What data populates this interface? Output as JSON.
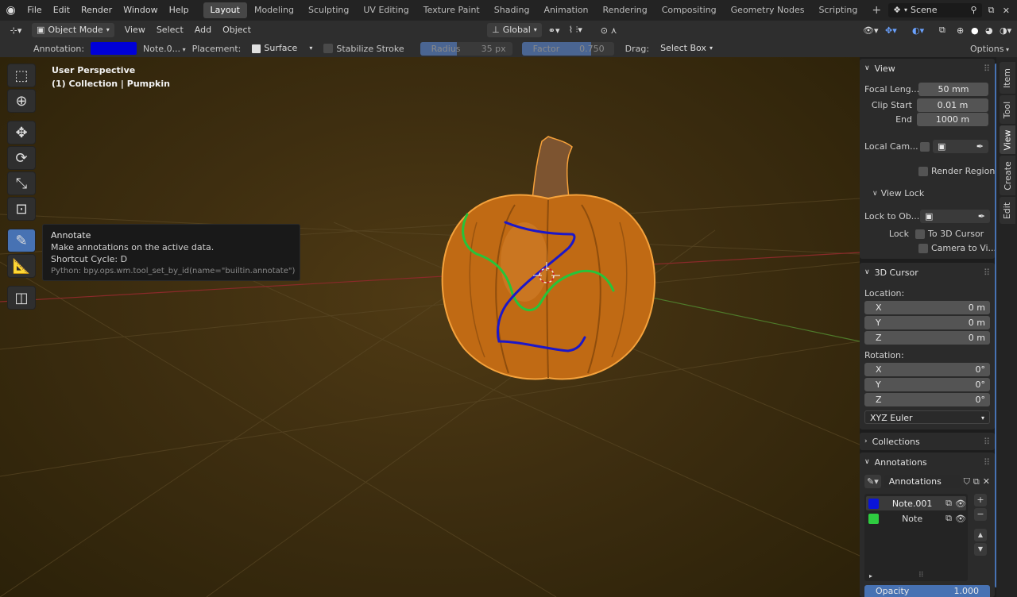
{
  "topbar": {
    "menus": [
      "File",
      "Edit",
      "Render",
      "Window",
      "Help"
    ],
    "workspaces": [
      "Layout",
      "Modeling",
      "Sculpting",
      "UV Editing",
      "Texture Paint",
      "Shading",
      "Animation",
      "Rendering",
      "Compositing",
      "Geometry Nodes",
      "Scripting"
    ],
    "active_workspace": "Layout",
    "add_tab": "+",
    "scene": "Scene"
  },
  "header": {
    "mode": "Object Mode",
    "menus": [
      "View",
      "Select",
      "Add",
      "Object"
    ],
    "transform": "Global"
  },
  "toolsettings": {
    "annotation_label": "Annotation:",
    "annotation_color": "#0000d8",
    "note": "Note.0...",
    "placement_label": "Placement:",
    "placement": "Surface",
    "stabilize": "Stabilize Stroke",
    "radius_label": "Radius",
    "radius_value": "35 px",
    "factor_label": "Factor",
    "factor_value": "0.750",
    "drag_label": "Drag:",
    "drag_value": "Select Box",
    "options": "Options"
  },
  "viewport": {
    "perspective": "User Perspective",
    "collection": "(1) Collection | Pumpkin"
  },
  "tooltip": {
    "title": "Annotate",
    "desc": "Make annotations on the active data.",
    "shortcut": "Shortcut Cycle: D",
    "python": "Python: bpy.ops.wm.tool_set_by_id(name=\"builtin.annotate\")"
  },
  "sidebar": {
    "tabs": [
      "Item",
      "Tool",
      "View",
      "Create",
      "Edit"
    ],
    "active_tab": "View",
    "view": {
      "title": "View",
      "focal_label": "Focal Leng...",
      "focal_value": "50 mm",
      "clip_start_label": "Clip Start",
      "clip_start_value": "0.01 m",
      "end_label": "End",
      "end_value": "1000 m",
      "local_cam": "Local Cam...",
      "render_region": "Render Region",
      "view_lock": "View Lock",
      "lock_to_obj": "Lock to Ob...",
      "lock_label": "Lock",
      "to_3d_cursor": "To 3D Cursor",
      "camera_to_view": "Camera to Vi..."
    },
    "cursor": {
      "title": "3D Cursor",
      "location": "Location:",
      "x": "X",
      "x_val": "0 m",
      "y": "Y",
      "y_val": "0 m",
      "z": "Z",
      "z_val": "0 m",
      "rotation": "Rotation:",
      "rx_val": "0°",
      "ry_val": "0°",
      "rz_val": "0°",
      "euler": "XYZ Euler"
    },
    "collections": "Collections",
    "annotations": {
      "title": "Annotations",
      "datablock": "Annotations",
      "layers": [
        {
          "name": "Note.001",
          "color": "#0a14d8"
        },
        {
          "name": "Note",
          "color": "#2ecc40"
        }
      ],
      "opacity_label": "Opacity",
      "opacity_value": "1.000"
    }
  }
}
